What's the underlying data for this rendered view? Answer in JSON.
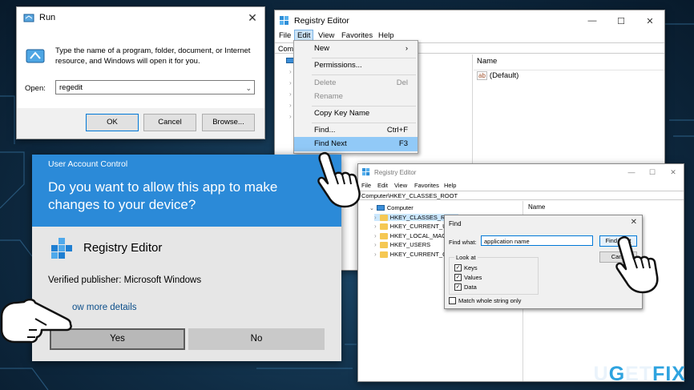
{
  "run_dialog": {
    "title": "Run",
    "description": "Type the name of a program, folder, document, or Internet resource, and Windows will open it for you.",
    "open_label": "Open:",
    "open_value": "regedit",
    "ok_label": "OK",
    "cancel_label": "Cancel",
    "browse_label": "Browse..."
  },
  "registry_editor_main": {
    "title": "Registry Editor",
    "menu": [
      "File",
      "Edit",
      "View",
      "Favorites",
      "Help"
    ],
    "address": "Com",
    "name_column": "Name",
    "default_value": "(Default)"
  },
  "edit_menu": {
    "items": [
      {
        "label": "New",
        "shortcut": "›",
        "enabled": true
      },
      {
        "label": "Permissions...",
        "shortcut": "",
        "enabled": true
      },
      {
        "label": "Delete",
        "shortcut": "Del",
        "enabled": false
      },
      {
        "label": "Rename",
        "shortcut": "",
        "enabled": false
      },
      {
        "label": "Copy Key Name",
        "shortcut": "",
        "enabled": true
      },
      {
        "label": "Find...",
        "shortcut": "Ctrl+F",
        "enabled": true
      },
      {
        "label": "Find Next",
        "shortcut": "F3",
        "enabled": true,
        "highlighted": true
      }
    ]
  },
  "uac_dialog": {
    "header": "User Account Control",
    "question": "Do you want to allow this app to make changes to your device?",
    "question_line1": "Do you want to allow this app to make",
    "question_line2": "changes to your device?",
    "app_name": "Registry Editor",
    "publisher": "Verified publisher: Microsoft Windows",
    "more_details": "ow more details",
    "yes_label": "Yes",
    "no_label": "No",
    "accent_color": "#2b8ad8"
  },
  "registry_editor_find": {
    "title": "Registry Editor",
    "menu": [
      "File",
      "Edit",
      "View",
      "Favorites",
      "Help"
    ],
    "address": "Computer\\HKEY_CLASSES_ROOT",
    "name_column": "Name",
    "tree": {
      "root": "Computer",
      "children": [
        "HKEY_CLASSES_ROOT",
        "HKEY_CURRENT_USE",
        "HKEY_LOCAL_MACH",
        "HKEY_USERS",
        "HKEY_CURRENT_CON"
      ]
    }
  },
  "find_dialog": {
    "title": "Find",
    "find_what_label": "Find what:",
    "find_what_value": "application name",
    "find_next_label": "Find Next",
    "cancel_label": "Canc",
    "look_at_label": "Look at",
    "options": [
      {
        "label": "Keys",
        "checked": true
      },
      {
        "label": "Values",
        "checked": true
      },
      {
        "label": "Data",
        "checked": true
      }
    ],
    "match_whole": {
      "label": "Match whole string only",
      "checked": false
    }
  },
  "watermark": {
    "part1": "U",
    "part2": "G",
    "part3": "ET",
    "part4": "FIX"
  }
}
